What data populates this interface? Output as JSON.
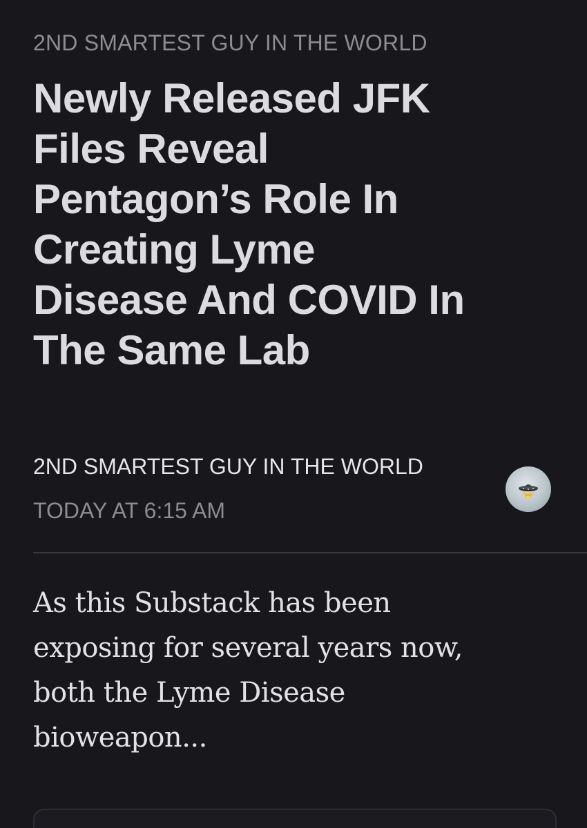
{
  "publication": "2ND SMARTEST GUY IN THE WORLD",
  "headline_lines": [
    "Newly Released JFK",
    "Files Reveal",
    "Pentagon’s Role In",
    "Creating Lyme",
    "Disease And COVID In",
    "The Same Lab"
  ],
  "byline": {
    "author": "2ND SMARTEST GUY IN THE WORLD",
    "timestamp": "TODAY AT 6:15 AM",
    "avatar_icon": "ufo-icon"
  },
  "excerpt_lines": [
    "As this Substack has been",
    "exposing for several years now,",
    "both the Lyme Disease",
    "bioweapon..."
  ],
  "colors": {
    "background": "#17171c",
    "muted_text": "#8c8c91",
    "primary_text": "#dcdcdf"
  }
}
